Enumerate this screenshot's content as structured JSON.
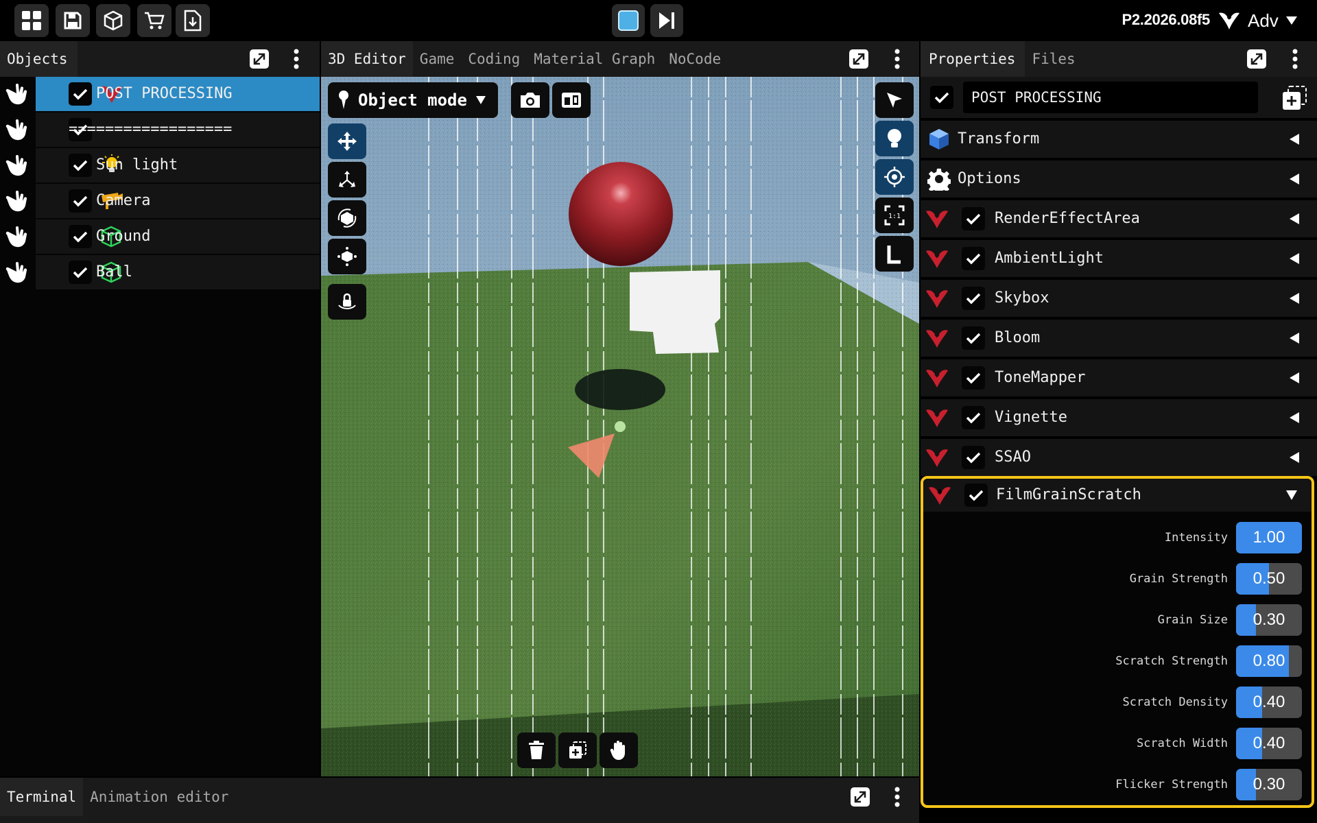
{
  "app": {
    "version": "P2.2026.08f5",
    "mode_label": "Adv"
  },
  "topbar": {
    "tools": [
      "grid-icon",
      "save-icon",
      "cube-icon",
      "cart-icon",
      "download-icon"
    ],
    "play": {
      "stop": "stop-icon",
      "step": "step-forward-icon"
    }
  },
  "objects_panel": {
    "tab": "Objects",
    "items": [
      {
        "label": "POST PROCESSING",
        "icon": "post-processing-icon",
        "checked": true,
        "selected": true
      },
      {
        "label": "==================",
        "icon": "",
        "checked": true,
        "selected": false
      },
      {
        "label": "Sun light",
        "icon": "bulb-icon",
        "checked": true,
        "selected": false
      },
      {
        "label": "Camera",
        "icon": "camera-icon",
        "checked": true,
        "selected": false
      },
      {
        "label": "Ground",
        "icon": "mesh-icon",
        "checked": true,
        "selected": false
      },
      {
        "label": "Ball",
        "icon": "mesh-icon",
        "checked": true,
        "selected": false
      }
    ]
  },
  "editor_panel": {
    "tabs": [
      "3D Editor",
      "Game",
      "Coding",
      "Material Graph",
      "NoCode"
    ],
    "active_tab": "3D Editor",
    "mode_dropdown": "Object mode"
  },
  "properties_panel": {
    "tabs": [
      "Properties",
      "Files"
    ],
    "active_tab": "Properties",
    "object_name": "POST PROCESSING",
    "object_enabled": true,
    "sections": [
      {
        "label": "Transform",
        "icon": "cube-icon"
      },
      {
        "label": "Options",
        "icon": "gear-icon"
      }
    ],
    "components": [
      {
        "label": "RenderEffectArea",
        "enabled": true,
        "expanded": false
      },
      {
        "label": "AmbientLight",
        "enabled": true,
        "expanded": false
      },
      {
        "label": "Skybox",
        "enabled": true,
        "expanded": false
      },
      {
        "label": "Bloom",
        "enabled": true,
        "expanded": false
      },
      {
        "label": "ToneMapper",
        "enabled": true,
        "expanded": false
      },
      {
        "label": "Vignette",
        "enabled": true,
        "expanded": false
      },
      {
        "label": "SSAO",
        "enabled": true,
        "expanded": false
      }
    ],
    "expanded_component": {
      "label": "FilmGrainScratch",
      "enabled": true,
      "highlight_color": "#f5c518",
      "fields": [
        {
          "label": "Intensity",
          "value": "1.00",
          "fraction": 1.0
        },
        {
          "label": "Grain Strength",
          "value": "0.50",
          "fraction": 0.5
        },
        {
          "label": "Grain Size",
          "value": "0.30",
          "fraction": 0.3
        },
        {
          "label": "Scratch Strength",
          "value": "0.80",
          "fraction": 0.8
        },
        {
          "label": "Scratch Density",
          "value": "0.40",
          "fraction": 0.4
        },
        {
          "label": "Scratch Width",
          "value": "0.40",
          "fraction": 0.4
        },
        {
          "label": "Flicker Strength",
          "value": "0.30",
          "fraction": 0.3
        }
      ]
    }
  },
  "bottom_panel": {
    "tabs": [
      "Terminal",
      "Animation editor"
    ],
    "active_tab": "Terminal"
  },
  "colors": {
    "selection": "#2c8ac4",
    "slider_fill": "#3b8ae9",
    "brand_red": "#c8202e",
    "mesh_green": "#2fd25a",
    "highlight_yellow": "#f5c518"
  }
}
